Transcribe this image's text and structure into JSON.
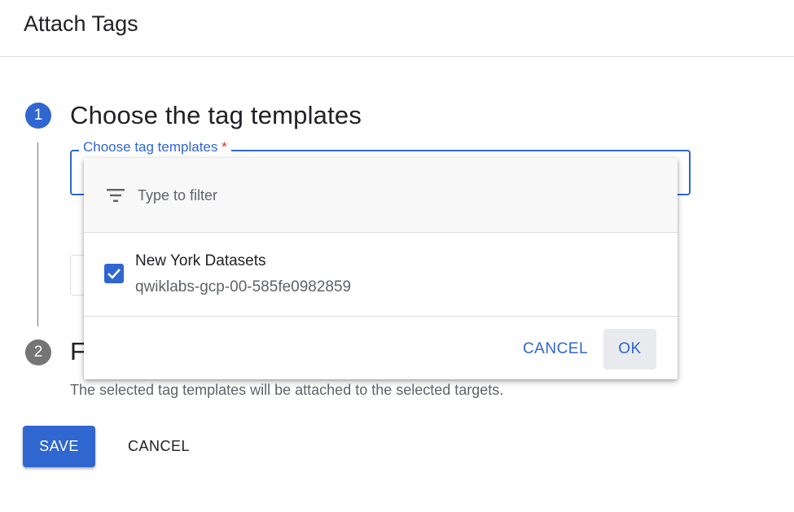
{
  "header": {
    "title": "Attach Tags"
  },
  "steps": [
    {
      "number": "1",
      "title": "Choose the tag templates"
    },
    {
      "number": "2",
      "title": "F"
    }
  ],
  "field": {
    "label": "Choose tag templates",
    "required_mark": "*"
  },
  "description": "The selected tag templates will be attached to the selected targets.",
  "actions": {
    "save_label": "SAVE",
    "cancel_label": "CANCEL"
  },
  "dropdown": {
    "filter_placeholder": "Type to filter",
    "filter_icon": "filter-list-icon",
    "options": [
      {
        "name": "New York Datasets",
        "project": "qwiklabs-gcp-00-585fe0982859",
        "checked": true
      }
    ],
    "cancel_label": "CANCEL",
    "ok_label": "OK"
  },
  "colors": {
    "accent": "#2f66d0",
    "required": "#d93025",
    "inactive_step": "#757575"
  }
}
